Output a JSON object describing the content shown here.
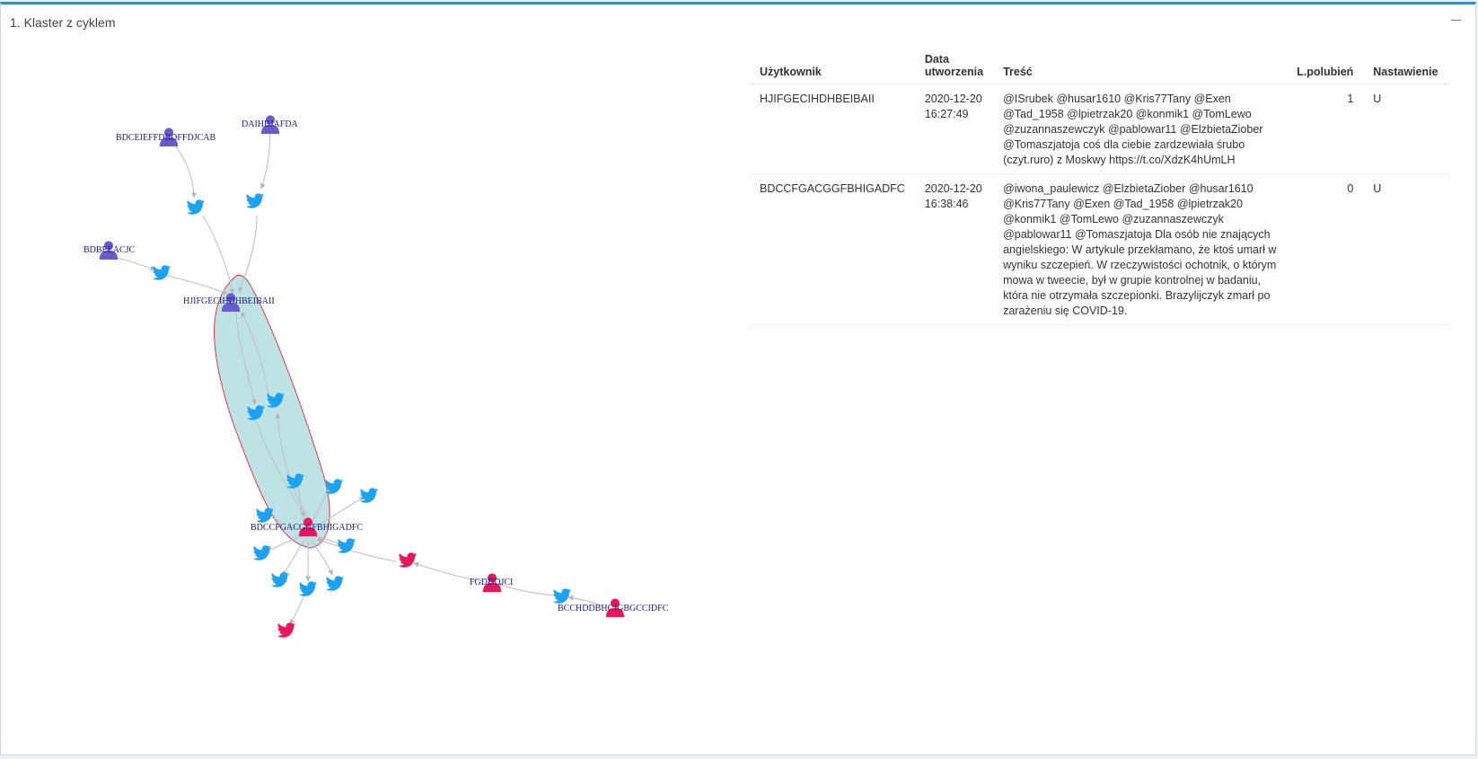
{
  "panel": {
    "title": "1. Klaster z cyklem"
  },
  "colors": {
    "accent": "#3c8dbc",
    "user_purple": "#6a5acd",
    "user_red": "#e8175d",
    "tweet_blue": "#1da1f2",
    "tweet_red": "#e8175d",
    "hull_fill": "#a9d8dd",
    "hull_stroke": "#e0393e"
  },
  "graph": {
    "labels": {
      "u1": "BDCEIEFFDBDFFDJCAB",
      "u2": "DAIHBJAFDA",
      "u3": "BDBEEACJC",
      "u4": "HJIFGECIHDHBEIBAII",
      "u5": "BDCCFGACGGFBHIGADFC",
      "u6": "FGDDDJCI",
      "u7": "BCCHDDBHCJGBGCCIDFC"
    },
    "icons": {
      "user": "user-icon",
      "tweet": "twitter-bird-icon"
    }
  },
  "table": {
    "headers": {
      "user": "Użytkownik",
      "date": "Data utworzenia",
      "content": "Treść",
      "likes": "L.polubień",
      "sentiment": "Nastawienie"
    },
    "rows": [
      {
        "user": "HJIFGECIHDHBEIBAII",
        "date": "2020-12-20 16:27:49",
        "content": "@ISrubek @husar1610 @Kris77Tany @Exen @Tad_1958 @lpietrzak20 @konmik1 @TomLewo @zuzannaszewczyk @pablowar11 @ElzbietaZiober @Tomaszjatoja coś dla ciebie zardzewiała śrubo (czyt.ruro) z Moskwy https://t.co/XdzK4hUmLH",
        "likes": "1",
        "sentiment": "U"
      },
      {
        "user": "BDCCFGACGGFBHIGADFC",
        "date": "2020-12-20 16:38:46",
        "content": "@iwona_paulewicz @ElzbietaZiober @husar1610 @Kris77Tany @Exen @Tad_1958 @lpietrzak20 @konmik1 @TomLewo @zuzannaszewczyk @pablowar11 @Tomaszjatoja Dla osób nie znających angielskiego: W artykule przekłamano, że ktoś umarł w wyniku szczepień. W rzeczywistości ochotnik, o którym mowa w tweecie, był w grupie kontrolnej w badaniu, która nie otrzymała szczepionki. Brazylijczyk zmarł po zarażeniu się COVID-19.",
        "likes": "0",
        "sentiment": "U"
      }
    ]
  }
}
